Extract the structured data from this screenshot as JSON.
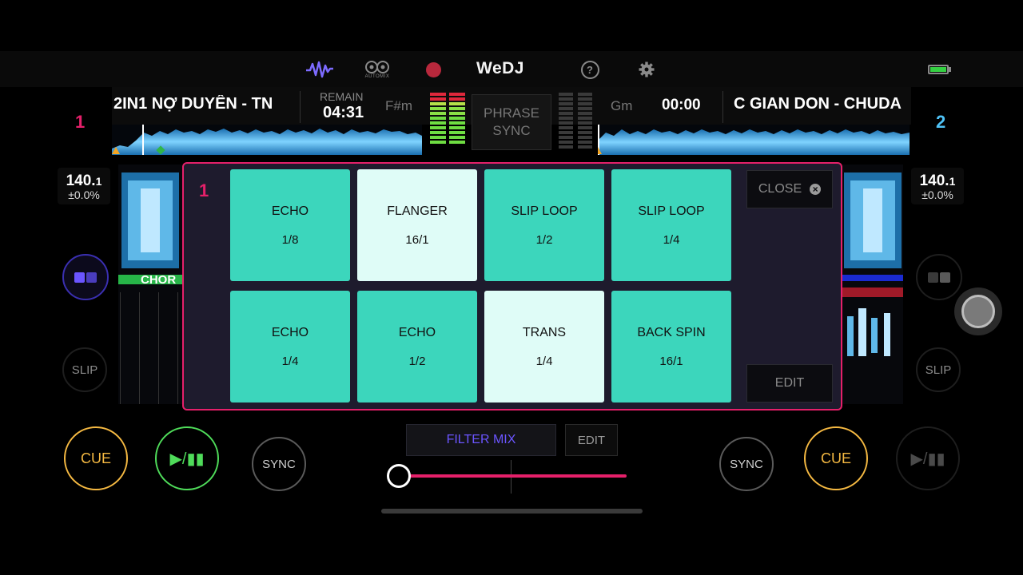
{
  "app": {
    "brand": "WeDJ"
  },
  "topbar": {
    "icons": [
      "waveform-icon",
      "automix-icon",
      "record-icon",
      "help-icon",
      "settings-icon",
      "battery-icon"
    ],
    "automix_label": "AUTOMIX",
    "help_label": "?"
  },
  "deck1": {
    "number": "1",
    "title": "2IN1 NỢ DUYÊN - TN",
    "remain_label": "REMAIN",
    "remain_time": "04:31",
    "key": "F#m",
    "bpm": "140.",
    "bpm_decimal": "1",
    "pitch": "±0.0%",
    "section_label": "CHOR",
    "slip_label": "SLIP",
    "cue_label": "CUE",
    "play_label": "▶/▮▮",
    "sync_label": "SYNC"
  },
  "deck2": {
    "number": "2",
    "title": "C GIAN DON - CHUDA",
    "key": "Gm",
    "time": "00:00",
    "bpm": "140.",
    "bpm_decimal": "1",
    "pitch": "±0.0%",
    "slip_label": "SLIP",
    "cue_label": "CUE",
    "play_label": "▶/▮▮",
    "sync_label": "SYNC"
  },
  "phrase_sync": {
    "line1": "PHRASE",
    "line2": "SYNC"
  },
  "pad_panel": {
    "deck_number": "1",
    "close_label": "CLOSE",
    "edit_label": "EDIT",
    "pads": [
      {
        "name": "ECHO",
        "value": "1/8",
        "state": "normal"
      },
      {
        "name": "FLANGER",
        "value": "16/1",
        "state": "active"
      },
      {
        "name": "SLIP LOOP",
        "value": "1/2",
        "state": "normal"
      },
      {
        "name": "SLIP LOOP",
        "value": "1/4",
        "state": "normal"
      },
      {
        "name": "ECHO",
        "value": "1/4",
        "state": "normal"
      },
      {
        "name": "ECHO",
        "value": "1/2",
        "state": "normal"
      },
      {
        "name": "TRANS",
        "value": "1/4",
        "state": "active"
      },
      {
        "name": "BACK SPIN",
        "value": "16/1",
        "state": "normal"
      }
    ]
  },
  "mixer": {
    "filter_label": "FILTER MIX",
    "edit_label": "EDIT",
    "crossfader_position": 0.0
  },
  "colors": {
    "accent_pink": "#e5206a",
    "pad_teal": "#3cd6bc",
    "pad_active": "#dffcf7",
    "deck1_number": "#e5206a",
    "deck2_number": "#4fc3f7",
    "cue": "#f5b942",
    "play": "#4fdc5a",
    "filter_text": "#6b55ff"
  }
}
